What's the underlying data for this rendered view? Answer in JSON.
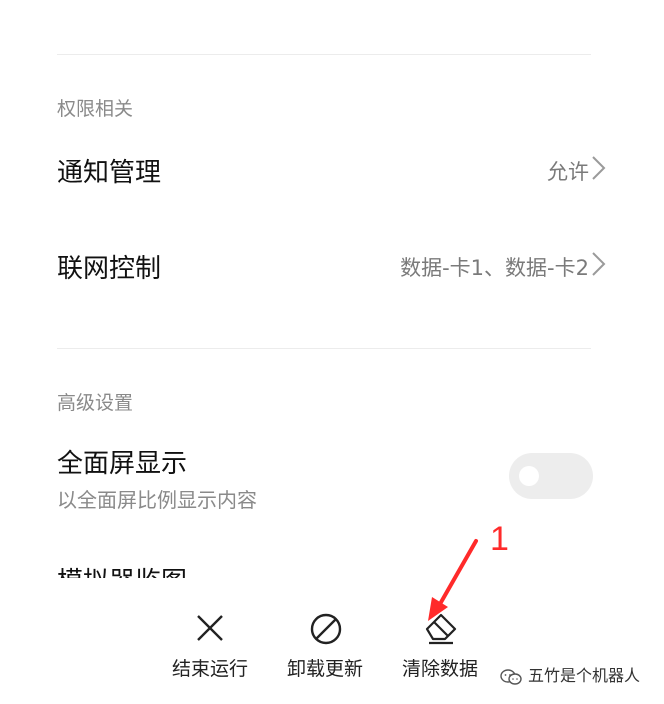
{
  "sections": {
    "permissions": {
      "title": "权限相关",
      "rows": [
        {
          "label": "通知管理",
          "value": "允许"
        },
        {
          "label": "联网控制",
          "value": "数据-卡1、数据-卡2"
        }
      ]
    },
    "advanced": {
      "title": "高级设置",
      "fullscreen": {
        "label": "全面屏显示",
        "subtitle": "以全面屏比例显示内容",
        "toggle_on": false
      },
      "partial_row_label": "模拟器监图"
    }
  },
  "bottom_actions": [
    {
      "label": "结束运行",
      "icon": "close-icon"
    },
    {
      "label": "卸载更新",
      "icon": "prohibit-icon"
    },
    {
      "label": "清除数据",
      "icon": "eraser-icon"
    }
  ],
  "annotation": {
    "number": "1",
    "color": "#ff2a2a"
  },
  "watermark": {
    "text": "五竹是个机器人",
    "icon": "wechat-icon"
  },
  "colors": {
    "accent_annotation": "#ff2a2a",
    "toggle_off": "#ededed"
  }
}
